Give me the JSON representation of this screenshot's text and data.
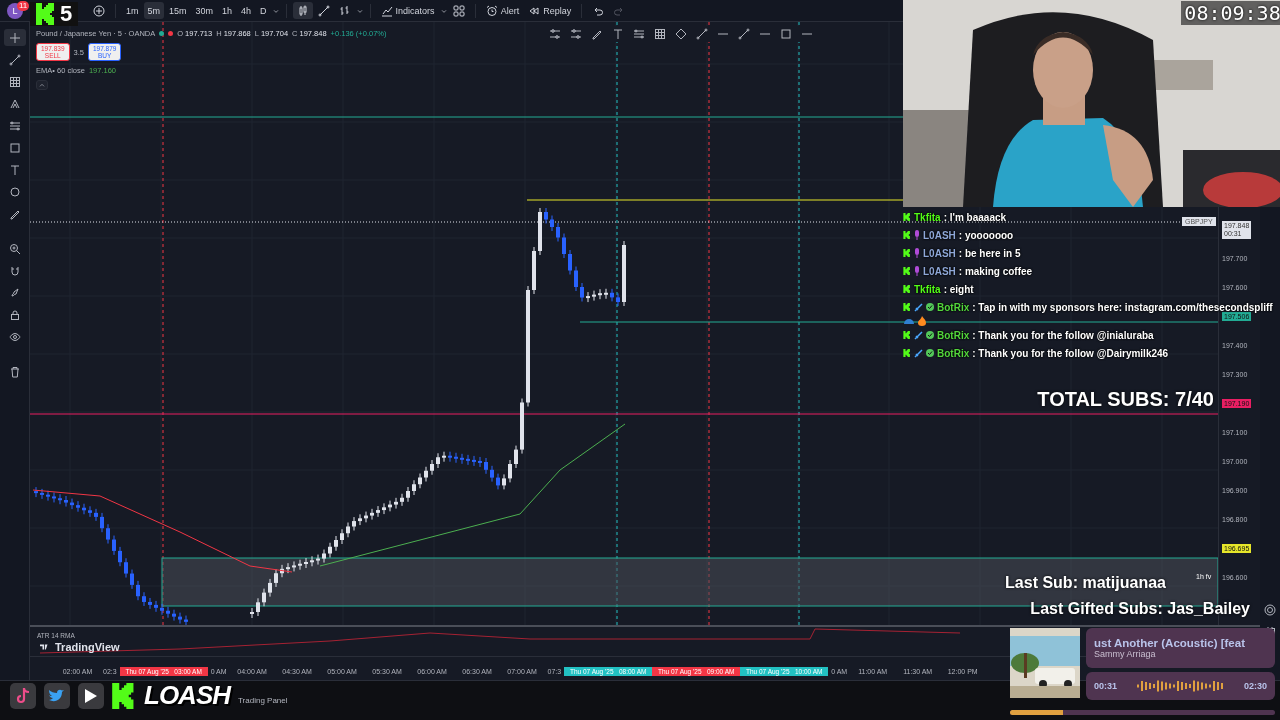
{
  "stream_overlay": {
    "logo_number": "5",
    "clock": "08:09:38",
    "total_subs": "TOTAL SUBS: 7/40",
    "last_sub": "Last Sub: matijuanaa",
    "last_gifted": "Last Gifted Subs: Jas_Bailey",
    "brand": "LOASH"
  },
  "toolbar": {
    "avatar": "L",
    "notifications": "11",
    "intervals": [
      {
        "label": "1m",
        "selected": false
      },
      {
        "label": "5m",
        "selected": true
      },
      {
        "label": "15m",
        "selected": false
      },
      {
        "label": "30m",
        "selected": false
      },
      {
        "label": "1h",
        "selected": false
      },
      {
        "label": "4h",
        "selected": false
      },
      {
        "label": "D",
        "selected": false
      }
    ],
    "chart_types": [
      {
        "kind": "candles",
        "selected": true
      },
      {
        "kind": "line",
        "selected": false
      },
      {
        "kind": "bars",
        "selected": false
      }
    ],
    "indicators": "Indicators",
    "alert": "Alert",
    "replay": "Replay"
  },
  "left_toolbar": [
    {
      "kind": "crosshair",
      "selected": true
    },
    {
      "kind": "line",
      "selected": false
    },
    {
      "kind": "grid",
      "selected": false
    },
    {
      "kind": "pitchfork",
      "selected": false
    },
    {
      "kind": "lines",
      "selected": false
    },
    {
      "kind": "square",
      "selected": false
    },
    {
      "kind": "text",
      "selected": false
    },
    {
      "kind": "circle",
      "selected": false
    },
    {
      "kind": "pencil",
      "selected": false
    },
    {
      "kind": "zoom",
      "selected": false
    },
    {
      "kind": "magnet",
      "selected": false
    },
    {
      "kind": "brush",
      "selected": false
    },
    {
      "kind": "lock",
      "selected": false
    },
    {
      "kind": "eye",
      "selected": false
    },
    {
      "kind": "trash",
      "selected": false
    }
  ],
  "chart": {
    "symbol": "Pound / Japanese Yen · 5 · OANDA",
    "ohlc": [
      {
        "label": "O",
        "value": "197.713"
      },
      {
        "label": "H",
        "value": "197.868"
      },
      {
        "label": "L",
        "value": "197.704"
      },
      {
        "label": "C",
        "value": "197.848"
      }
    ],
    "change": "+0.136 (+0.07%)",
    "sell_price": "197.839",
    "sell": "SELL",
    "spread": "3.5",
    "buy_price": "197.879",
    "buy": "BUY",
    "ema_label": "EMA• 60 close",
    "ema_value": "197.160",
    "zone_label": "1h fv",
    "pair": "GBPJPY"
  },
  "price_axis": [
    {
      "kind": "current",
      "value": "197.848",
      "countdown": "00:31"
    },
    {
      "kind": "tick",
      "value": "197.700"
    },
    {
      "kind": "tick",
      "value": "197.600"
    },
    {
      "kind": "tag",
      "value": "197.506",
      "color": "#22ab94"
    },
    {
      "kind": "tick",
      "value": "197.400"
    },
    {
      "kind": "tick",
      "value": "197.300"
    },
    {
      "kind": "tag",
      "value": "197.190",
      "color": "#e91e63"
    },
    {
      "kind": "tick",
      "value": "197.100"
    },
    {
      "kind": "tick",
      "value": "197.000"
    },
    {
      "kind": "tick",
      "value": "196.900"
    },
    {
      "kind": "tick",
      "value": "196.800"
    },
    {
      "kind": "tag",
      "value": "196.695",
      "color": "#e6e62a"
    },
    {
      "kind": "tick",
      "value": "196.600"
    }
  ],
  "indicator_pane": {
    "label": "ATR 14 RMA",
    "brand": "TradingView"
  },
  "time_axis": [
    {
      "kind": "tick",
      "label": "02:00 AM"
    },
    {
      "kind": "tick",
      "label": "02:3"
    },
    {
      "kind": "tag",
      "label": "Thu 07 Aug '25   03:00 AM",
      "color": "#f23645"
    },
    {
      "kind": "tick",
      "label": "0 AM"
    },
    {
      "kind": "tick",
      "label": "04:00 AM"
    },
    {
      "kind": "tick",
      "label": "04:30 AM"
    },
    {
      "kind": "tick",
      "label": "05:00 AM"
    },
    {
      "kind": "tick",
      "label": "05:30 AM"
    },
    {
      "kind": "tick",
      "label": "06:00 AM"
    },
    {
      "kind": "tick",
      "label": "06:30 AM"
    },
    {
      "kind": "tick",
      "label": "07:00 AM"
    },
    {
      "kind": "tick",
      "label": "07:3"
    },
    {
      "kind": "tag",
      "label": "Thu 07 Aug '25   08:00 AM",
      "color": "#22c1c3"
    },
    {
      "kind": "tag",
      "label": "Thu 07 Aug '25   09:00 AM",
      "color": "#f23645"
    },
    {
      "kind": "tag",
      "label": "Thu 07 Aug '25   10:00 AM",
      "color": "#22c1c3"
    },
    {
      "kind": "tick",
      "label": "0 AM"
    },
    {
      "kind": "tick",
      "label": "11:00 AM"
    },
    {
      "kind": "tick",
      "label": "11:30 AM"
    },
    {
      "kind": "tick",
      "label": "12:00 PM"
    }
  ],
  "bottom_bar": {
    "trading_panel": "Trading Panel"
  },
  "chat": [
    {
      "kind": "viewer",
      "user": "Tkfita",
      "text": ": I'm baaaack",
      "color": "#53fc18"
    },
    {
      "kind": "broadcaster",
      "user": "L0ASH",
      "text": ": yooooooo",
      "color": "#8ea7d8"
    },
    {
      "kind": "broadcaster",
      "user": "L0ASH",
      "text": ": be here in 5",
      "color": "#8ea7d8"
    },
    {
      "kind": "broadcaster",
      "user": "L0ASH",
      "text": ": making coffee",
      "color": "#8ea7d8"
    },
    {
      "kind": "viewer",
      "user": "Tkfita",
      "text": ": eight",
      "color": "#53fc18"
    },
    {
      "kind": "bot",
      "user": "BotRix",
      "text": ": Tap in with my sponsors here: instagram.com/thesecondspliff",
      "color": "#53d63c"
    },
    {
      "kind": "emotes"
    },
    {
      "kind": "bot",
      "user": "BotRix",
      "text": ": Thank you for the follow @inialuraba",
      "color": "#53d63c"
    },
    {
      "kind": "bot",
      "user": "BotRix",
      "text": ": Thank you for the follow @Dairymilk246",
      "color": "#53d63c"
    }
  ],
  "music": {
    "title": "ust Another (Acoustic) [feat",
    "artist": "Sammy Arriaga",
    "elapsed": "00:31",
    "total": "02:30",
    "level": 0.2
  }
}
